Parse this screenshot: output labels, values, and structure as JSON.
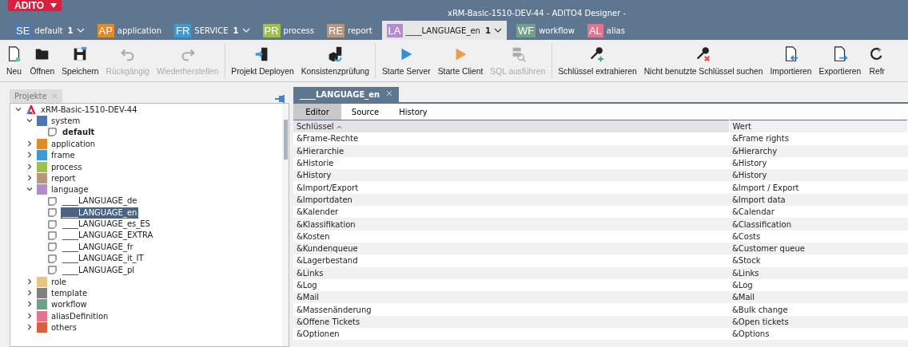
{
  "app_menu": {
    "logo": "ADITO"
  },
  "window": {
    "title": "xRM-Basic-1510-DEV-44 - ADITO4 Designer -"
  },
  "project_tabs": [
    {
      "code": "SE",
      "label": "default",
      "count": "1",
      "color": "#4a78b0",
      "selected": false
    },
    {
      "code": "AP",
      "label": "application",
      "color": "#e08a2e",
      "selected": false
    },
    {
      "code": "FR",
      "label": "SERVICE",
      "count": "1",
      "color": "#3d9bd3",
      "selected": false
    },
    {
      "code": "PR",
      "label": "process",
      "color": "#9fbf4a",
      "selected": false
    },
    {
      "code": "RE",
      "label": "report",
      "color": "#b9967a",
      "selected": false
    },
    {
      "code": "LA",
      "label": "____LANGUAGE_en",
      "count": "1",
      "color": "#b48ccd",
      "selected": true
    },
    {
      "code": "WF",
      "label": "workflow",
      "color": "#6fa08a",
      "selected": false
    },
    {
      "code": "AL",
      "label": "alias",
      "color": "#e2758e",
      "selected": false
    }
  ],
  "toolbar": [
    {
      "label": "Neu",
      "disabled": false
    },
    {
      "label": "Öffnen",
      "disabled": false
    },
    {
      "label": "Speichern",
      "disabled": false
    },
    {
      "label": "Rückgängig",
      "disabled": true
    },
    {
      "label": "Wiederherstellen",
      "disabled": true
    },
    {
      "label": "Projekt Deployen",
      "disabled": false
    },
    {
      "label": "Konsistenzprüfung",
      "disabled": false
    },
    {
      "label": "Starte Server",
      "disabled": false
    },
    {
      "label": "Starte Client",
      "disabled": false
    },
    {
      "label": "SQL ausführen",
      "disabled": true
    },
    {
      "label": "Schlüssel extrahieren",
      "disabled": false
    },
    {
      "label": "Nicht benutzte Schlüssel suchen",
      "disabled": false
    },
    {
      "label": "Importieren",
      "disabled": false
    },
    {
      "label": "Exportieren",
      "disabled": false
    },
    {
      "label": "Refr",
      "disabled": false
    }
  ],
  "projects_panel": {
    "tab": "Projekte",
    "tree": [
      {
        "label": "xRM-Basic-1510-DEV-44",
        "kind": "project",
        "expanded": true,
        "children": [
          {
            "label": "system",
            "kind": "folder",
            "color": "#4a78b0",
            "expanded": true,
            "children": [
              {
                "label": "default",
                "kind": "file",
                "bold": true,
                "selected": false
              }
            ]
          },
          {
            "label": "application",
            "kind": "folder",
            "color": "#e08a2e",
            "expanded": false
          },
          {
            "label": "frame",
            "kind": "folder",
            "color": "#3d9bd3",
            "expanded": false
          },
          {
            "label": "process",
            "kind": "folder",
            "color": "#9fbf4a",
            "expanded": false
          },
          {
            "label": "report",
            "kind": "folder",
            "color": "#b9967a",
            "expanded": false
          },
          {
            "label": "language",
            "kind": "folder",
            "color": "#b48ccd",
            "expanded": true,
            "children": [
              {
                "label": "____LANGUAGE_de",
                "kind": "file",
                "bold": false,
                "selected": false
              },
              {
                "label": "____LANGUAGE_en",
                "kind": "file",
                "bold": false,
                "selected": true
              },
              {
                "label": "____LANGUAGE_es_ES",
                "kind": "file",
                "bold": false,
                "selected": false
              },
              {
                "label": "____LANGUAGE_EXTRA",
                "kind": "file",
                "bold": false,
                "selected": false
              },
              {
                "label": "____LANGUAGE_fr",
                "kind": "file",
                "bold": false,
                "selected": false
              },
              {
                "label": "____LANGUAGE_it_IT",
                "kind": "file",
                "bold": false,
                "selected": false
              },
              {
                "label": "____LANGUAGE_pl",
                "kind": "file",
                "bold": false,
                "selected": false
              }
            ]
          },
          {
            "label": "role",
            "kind": "folder",
            "color": "#ebc47f",
            "expanded": false
          },
          {
            "label": "template",
            "kind": "folder",
            "color": "#808080",
            "expanded": false
          },
          {
            "label": "workflow",
            "kind": "folder",
            "color": "#6fa08a",
            "expanded": false
          },
          {
            "label": "aliasDefinition",
            "kind": "folder",
            "color": "#e2758e",
            "expanded": false
          },
          {
            "label": "others",
            "kind": "folder",
            "color": "#d8603f",
            "expanded": false
          }
        ]
      }
    ]
  },
  "editor": {
    "tab": "____LANGUAGE_en",
    "subtabs": [
      {
        "label": "Editor",
        "selected": true
      },
      {
        "label": "Source",
        "selected": false
      },
      {
        "label": "History",
        "selected": false
      }
    ],
    "table": {
      "columns": [
        {
          "label": "Schlüssel",
          "sorted": true
        },
        {
          "label": "Wert",
          "sorted": false
        }
      ],
      "rows": [
        [
          "&Frame-Rechte",
          "&Frame rights"
        ],
        [
          "&Hierarchie",
          "&Hierarchy"
        ],
        [
          "&Historie",
          "&History"
        ],
        [
          "&History",
          "&History"
        ],
        [
          "&Import/Export",
          "&Import / Export"
        ],
        [
          "&Importdaten",
          "&Import data"
        ],
        [
          "&Kalender",
          "&Calendar"
        ],
        [
          "&Klassifikation",
          "&Classification"
        ],
        [
          "&Kosten",
          "&Costs"
        ],
        [
          "&Kundenqueue",
          "&Customer queue"
        ],
        [
          "&Lagerbestand",
          "&Stock"
        ],
        [
          "&Links",
          "&Links"
        ],
        [
          "&Log",
          "&Log"
        ],
        [
          "&Mail",
          "&Mail"
        ],
        [
          "&Massenänderung",
          "&Bulk change"
        ],
        [
          "&Offene Tickets",
          "&Open tickets"
        ],
        [
          "&Optionen",
          "&Options"
        ]
      ]
    }
  }
}
